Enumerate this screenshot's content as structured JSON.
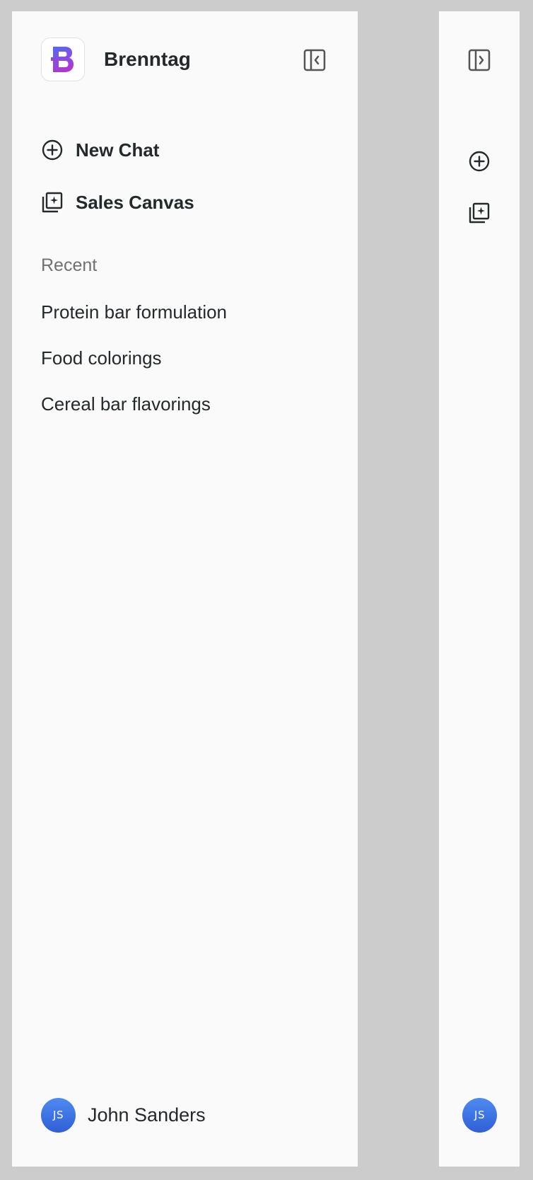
{
  "brand": {
    "name": "Brenntag",
    "logo_letter": "B",
    "logo_gradient": [
      "#5b5cf0",
      "#a93bd6"
    ]
  },
  "sidebar": {
    "toggle_collapse_icon": "sidebar-collapse-icon",
    "toggle_expand_icon": "sidebar-expand-icon",
    "nav": [
      {
        "label": "New Chat",
        "icon": "plus-circle-icon"
      },
      {
        "label": "Sales Canvas",
        "icon": "sparkle-stack-icon"
      }
    ],
    "recent_heading": "Recent",
    "recent": [
      "Protein bar formulation",
      "Food colorings",
      "Cereal bar flavorings"
    ]
  },
  "user": {
    "initials": "JS",
    "name": "John Sanders",
    "avatar_color": "#3b6fe0"
  },
  "colors": {
    "page_bg": "#cccccc",
    "panel_bg": "#fafafa",
    "text": "#24292b",
    "muted": "#717171"
  }
}
